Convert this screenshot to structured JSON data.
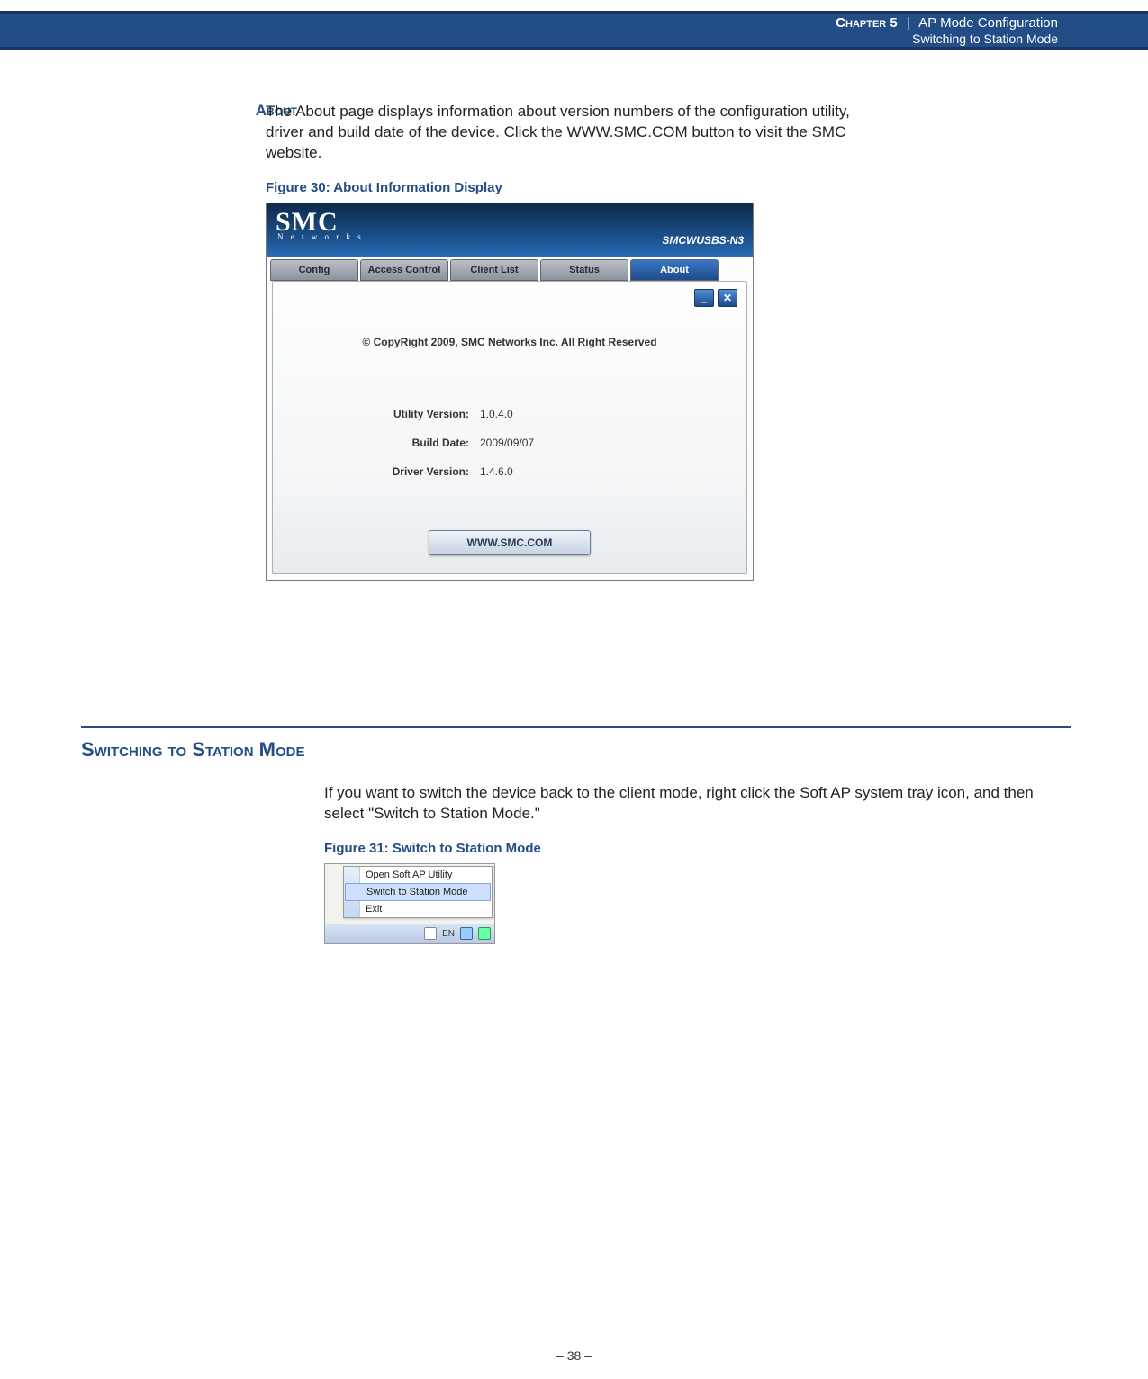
{
  "header": {
    "chapter": "Chapter 5",
    "pipe": "|",
    "title": "AP Mode Configuration",
    "subtitle": "Switching to Station Mode"
  },
  "about": {
    "side_label": "About",
    "body": "The About page displays information about version numbers of the configuration utility, driver and build date of the device. Click the WWW.SMC.COM button to visit the SMC website.",
    "figure_caption": "Figure 30:  About Information Display"
  },
  "screenshot1": {
    "logo": "SMC",
    "logo_sub": "N e t w o r k s",
    "model": "SMCWUSBS-N3",
    "tabs": [
      "Config",
      "Access Control",
      "Client List",
      "Status",
      "About"
    ],
    "active_tab_index": 4,
    "minimize_glyph": "_",
    "close_glyph": "✕",
    "copyright": "© CopyRight 2009, SMC Networks Inc. All Right Reserved",
    "rows": [
      {
        "label": "Utility Version:",
        "value": "1.0.4.0"
      },
      {
        "label": "Build Date:",
        "value": "2009/09/07"
      },
      {
        "label": "Driver Version:",
        "value": "1.4.6.0"
      }
    ],
    "link_button": "WWW.SMC.COM"
  },
  "section2": {
    "heading": "Switching to Station Mode",
    "body": "If you want to switch the device back to the client mode, right click the Soft AP system tray icon, and then select \"Switch to Station Mode.\"",
    "figure_caption": "Figure 31:  Switch to Station Mode"
  },
  "screenshot2": {
    "menu_items": [
      "Open Soft AP Utility",
      "Switch to Station Mode",
      "Exit"
    ],
    "selected_index": 1,
    "tray_lang": "EN"
  },
  "page_number": "–  38  –"
}
